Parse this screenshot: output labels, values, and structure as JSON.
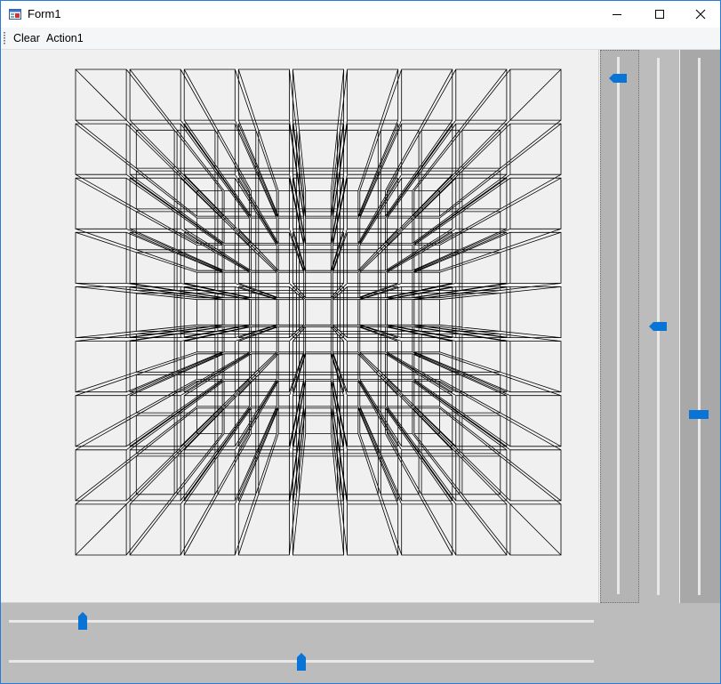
{
  "window": {
    "title": "Form1",
    "accent_color": "#2b7bd6"
  },
  "caption_buttons": {
    "minimize_icon": "minimize-icon",
    "maximize_icon": "maximize-icon",
    "close_icon": "close-icon"
  },
  "menu": {
    "items": [
      {
        "label": "Clear"
      },
      {
        "label": "Action1"
      }
    ]
  },
  "drawing": {
    "description_icon": "wireframe-cube-grid",
    "grid_columns": 9,
    "grid_rows": 9,
    "line_color": "#000000",
    "background_color": "#f0f0f0"
  },
  "trackbars": {
    "thumb_color": "#0a74d6",
    "vertical": [
      {
        "name": "vertical-trackbar-1",
        "value_fraction": 0.04
      },
      {
        "name": "vertical-trackbar-2",
        "value_fraction": 0.5
      },
      {
        "name": "vertical-trackbar-3",
        "value_fraction": 0.66
      }
    ],
    "horizontal": [
      {
        "name": "horizontal-trackbar-1",
        "value_fraction": 0.13
      },
      {
        "name": "horizontal-trackbar-2",
        "value_fraction": 0.5
      }
    ]
  }
}
